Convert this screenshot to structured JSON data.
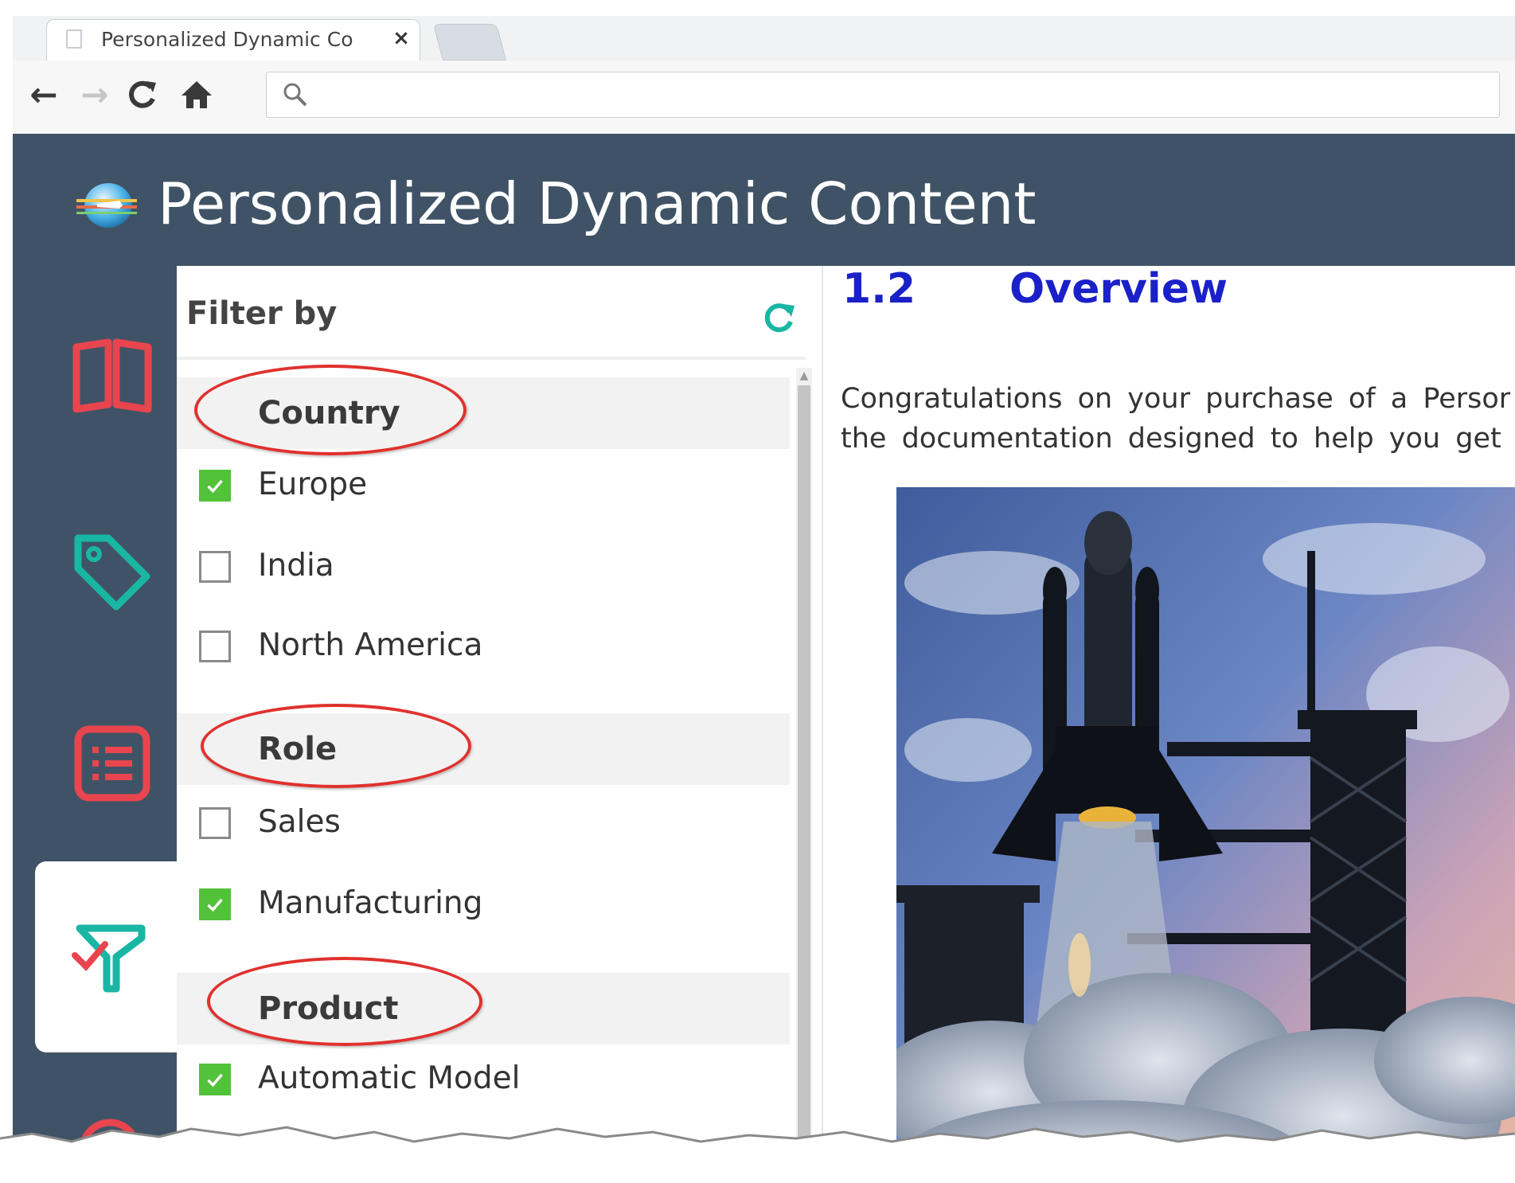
{
  "browser": {
    "tab_title": "Personalized Dynamic Co",
    "close_glyph": "×",
    "address_value": "",
    "back_glyph": "←",
    "forward_glyph": "→",
    "reload_glyph": "C",
    "home_glyph": "⌂"
  },
  "app": {
    "title": "Personalized Dynamic Content",
    "header_color": "#405366"
  },
  "rail": {
    "items": [
      {
        "icon": "book-icon"
      },
      {
        "icon": "tag-icon"
      },
      {
        "icon": "list-icon"
      },
      {
        "icon": "filter-icon",
        "active": true
      },
      {
        "icon": "search-icon"
      }
    ]
  },
  "filter": {
    "title": "Filter by",
    "groups": [
      {
        "label": "Country",
        "options": [
          {
            "label": "Europe",
            "checked": true
          },
          {
            "label": "India",
            "checked": false
          },
          {
            "label": "North America",
            "checked": false
          }
        ]
      },
      {
        "label": "Role",
        "options": [
          {
            "label": "Sales",
            "checked": false
          },
          {
            "label": "Manufacturing",
            "checked": true
          }
        ]
      },
      {
        "label": "Product",
        "options": [
          {
            "label": "Automatic Model",
            "checked": true
          }
        ]
      }
    ]
  },
  "content": {
    "section_number": "1.2",
    "section_title": "Overview",
    "paragraph_line1": "Congratulations on your purchase of a Persor",
    "paragraph_line2": "the documentation designed to help you get",
    "heading_color": "#1b21c8"
  },
  "colors": {
    "rail_icon": "#e8454f",
    "accent_teal": "#1ab6a4",
    "checkbox_on": "#52c23a",
    "annotation_red": "#e0312e"
  }
}
